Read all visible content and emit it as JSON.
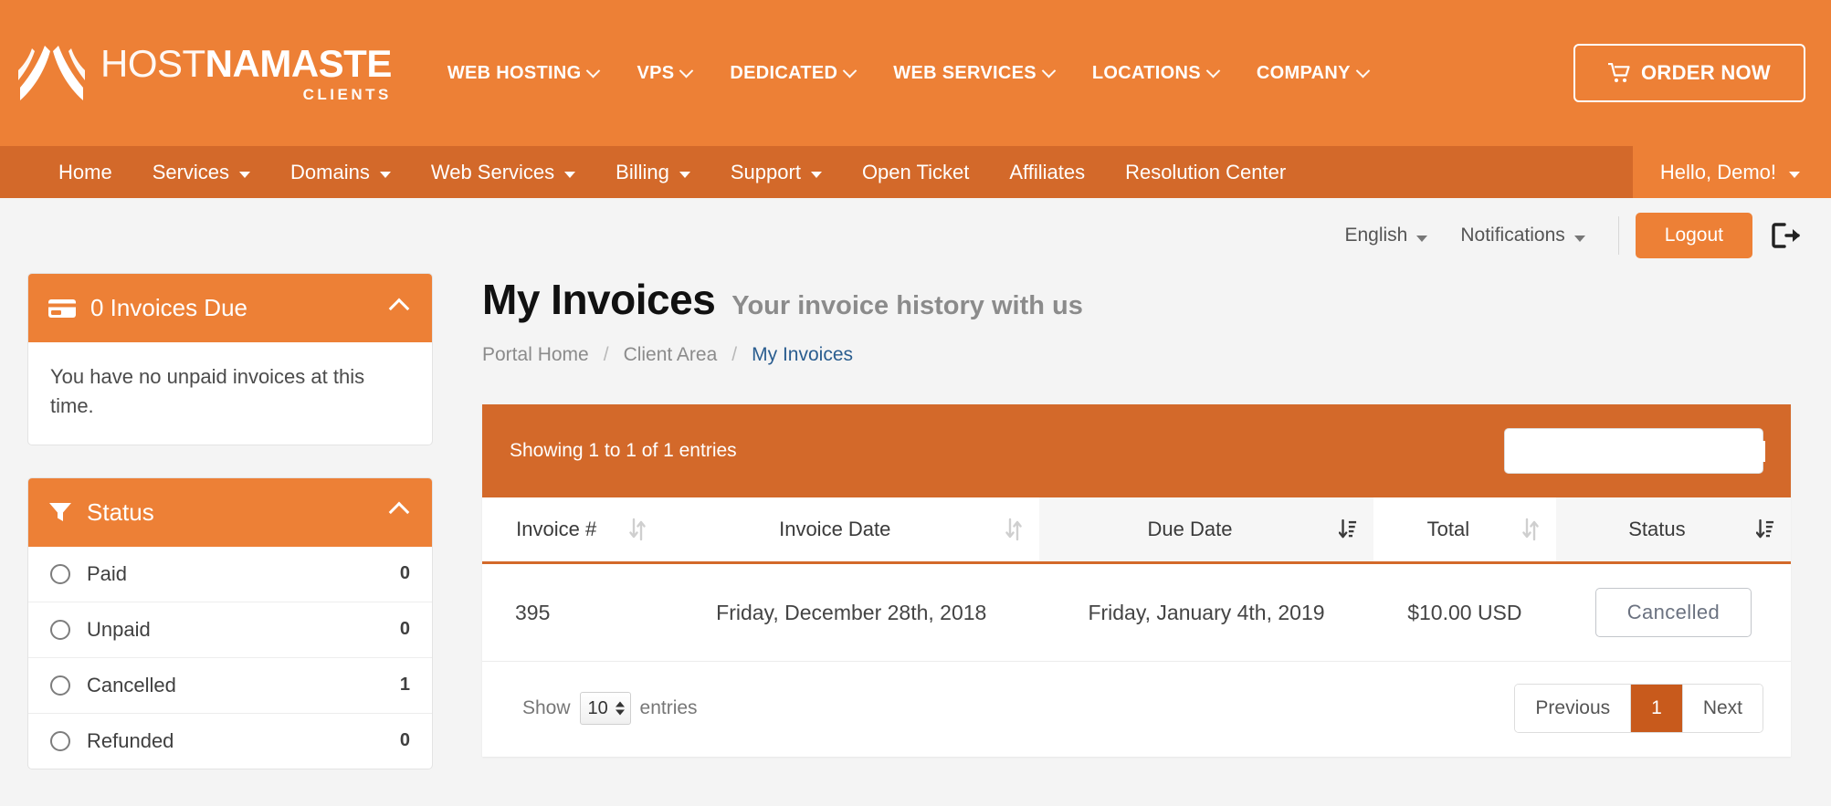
{
  "brand": {
    "logo_icon": "namaste-hands-logo",
    "name_thin": "HOST",
    "name_bold": "NAMASTE",
    "sub": "CLIENTS"
  },
  "topnav": {
    "items": [
      {
        "label": "WEB HOSTING",
        "caret": true
      },
      {
        "label": "VPS",
        "caret": true
      },
      {
        "label": "DEDICATED",
        "caret": true
      },
      {
        "label": "WEB SERVICES",
        "caret": true
      },
      {
        "label": "LOCATIONS",
        "caret": true
      },
      {
        "label": "COMPANY",
        "caret": true
      }
    ],
    "order_now": "ORDER NOW",
    "cart_icon": "shopping-cart-icon"
  },
  "subnav": {
    "items": [
      {
        "label": "Home",
        "caret": false
      },
      {
        "label": "Services",
        "caret": true
      },
      {
        "label": "Domains",
        "caret": true
      },
      {
        "label": "Web Services",
        "caret": true
      },
      {
        "label": "Billing",
        "caret": true
      },
      {
        "label": "Support",
        "caret": true
      },
      {
        "label": "Open Ticket",
        "caret": false
      },
      {
        "label": "Affiliates",
        "caret": false
      },
      {
        "label": "Resolution Center",
        "caret": false
      }
    ],
    "user_greeting": "Hello, Demo!"
  },
  "utilbar": {
    "language": "English",
    "notifications": "Notifications",
    "logout": "Logout",
    "logout_icon": "sign-out-icon"
  },
  "sidebar": {
    "invoices_due": {
      "icon": "credit-card-icon",
      "title": "0 Invoices Due",
      "collapse_icon": "chevron-up-icon",
      "body": "You have no unpaid invoices at this time."
    },
    "status_filter": {
      "icon": "filter-icon",
      "title": "Status",
      "collapse_icon": "chevron-up-icon",
      "options": [
        {
          "label": "Paid",
          "count": "0"
        },
        {
          "label": "Unpaid",
          "count": "0"
        },
        {
          "label": "Cancelled",
          "count": "1"
        },
        {
          "label": "Refunded",
          "count": "0"
        }
      ]
    }
  },
  "main": {
    "title": "My Invoices",
    "subtitle": "Your invoice history with us",
    "breadcrumb": [
      {
        "label": "Portal Home",
        "active": false
      },
      {
        "label": "Client Area",
        "active": false
      },
      {
        "label": "My Invoices",
        "active": true
      }
    ],
    "breadcrumb_separator": "/"
  },
  "table": {
    "showing": "Showing 1 to 1 of 1 entries",
    "search_placeholder": "",
    "search_value": "",
    "search_icon": "search-icon",
    "columns": [
      {
        "label": "Invoice #",
        "sort": "sort-both-icon",
        "sorted": false
      },
      {
        "label": "Invoice Date",
        "sort": "sort-both-icon",
        "sorted": false
      },
      {
        "label": "Due Date",
        "sort": "sort-desc-icon",
        "sorted": true
      },
      {
        "label": "Total",
        "sort": "sort-both-icon",
        "sorted": false
      },
      {
        "label": "Status",
        "sort": "sort-desc-icon",
        "sorted": true
      }
    ],
    "rows": [
      {
        "invoice_number": "395",
        "invoice_date": "Friday, December 28th, 2018",
        "due_date": "Friday, January 4th, 2019",
        "total": "$10.00 USD",
        "status": "Cancelled"
      }
    ],
    "footer": {
      "show_label": "Show",
      "page_size": "10",
      "entries_label": "entries",
      "previous": "Previous",
      "page_current": "1",
      "next": "Next"
    }
  },
  "colors": {
    "brand_orange": "#ed8036",
    "brand_orange_dark": "#d3692a",
    "page_bg": "#f4f4f4",
    "link_blue": "#2a5d8f",
    "pagination_active": "#c85a1c"
  }
}
